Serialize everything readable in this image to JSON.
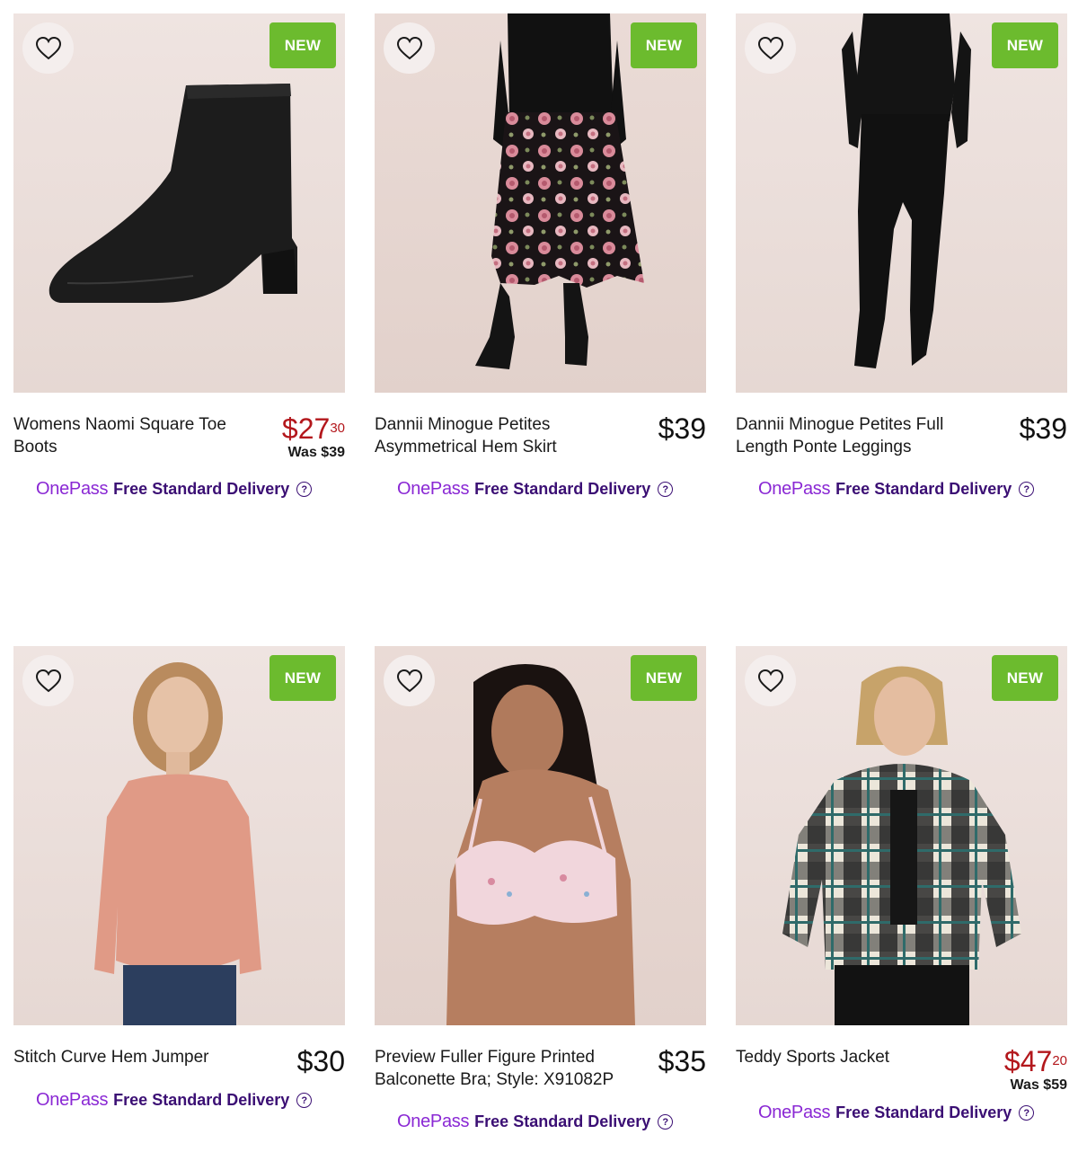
{
  "products": [
    {
      "title": "Womens Naomi Square Toe Boots",
      "badge": "NEW",
      "price_main": "$27",
      "price_cents": "30",
      "was": "Was $39",
      "image": "black-ankle-boot",
      "onepass_logo": "OnePass",
      "delivery": "Free Standard Delivery",
      "help": "?"
    },
    {
      "title": "Dannii Minogue Petites Asymmetrical Hem Skirt",
      "badge": "NEW",
      "price_main": "$39",
      "price_cents": "",
      "was": "",
      "image": "floral-skirt",
      "onepass_logo": "OnePass",
      "delivery": "Free Standard Delivery",
      "help": "?"
    },
    {
      "title": "Dannii Minogue Petites Full Length Ponte Leggings",
      "badge": "NEW",
      "price_main": "$39",
      "price_cents": "",
      "was": "",
      "image": "black-leggings",
      "onepass_logo": "OnePass",
      "delivery": "Free Standard Delivery",
      "help": "?"
    },
    {
      "title": "Stitch Curve Hem Jumper",
      "badge": "NEW",
      "price_main": "$30",
      "price_cents": "",
      "was": "",
      "image": "pink-jumper",
      "onepass_logo": "OnePass",
      "delivery": "Free Standard Delivery",
      "help": "?"
    },
    {
      "title": "Preview Fuller Figure Printed Balconette Bra; Style: X91082P",
      "badge": "NEW",
      "price_main": "$35",
      "price_cents": "",
      "was": "",
      "image": "floral-bra",
      "onepass_logo": "OnePass",
      "delivery": "Free Standard Delivery",
      "help": "?"
    },
    {
      "title": "Teddy Sports Jacket",
      "badge": "NEW",
      "price_main": "$47",
      "price_cents": "20",
      "was": "Was $59",
      "image": "plaid-jacket",
      "onepass_logo": "OnePass",
      "delivery": "Free Standard Delivery",
      "help": "?"
    }
  ],
  "colors": {
    "new_badge": "#6cbb2e",
    "sale_price": "#b3171c",
    "onepass": "#8a28d4",
    "delivery_text": "#3b0f74"
  }
}
